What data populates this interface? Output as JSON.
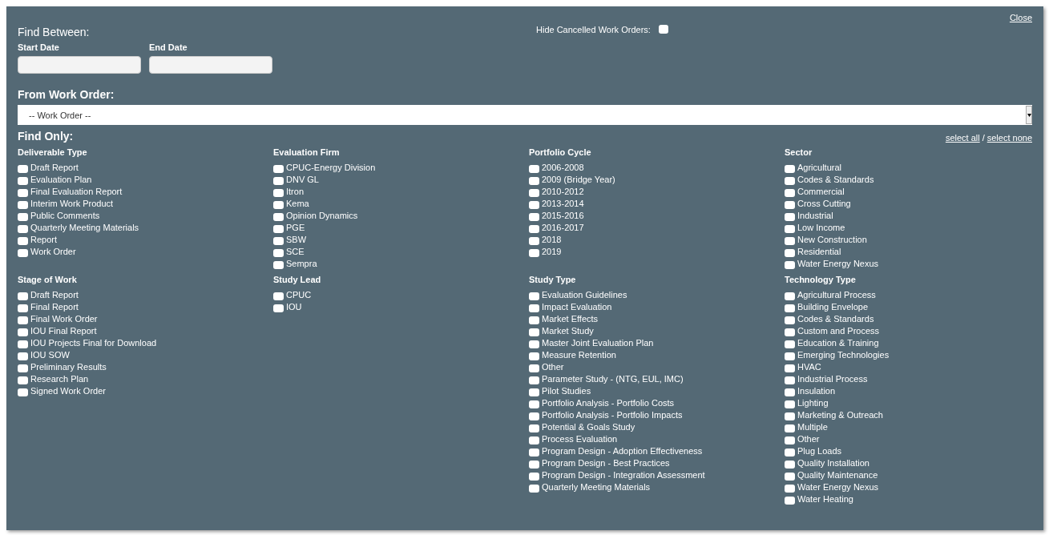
{
  "close_link": "Close",
  "find_between": {
    "title": "Find Between:",
    "start_date": {
      "label": "Start Date"
    },
    "end_date": {
      "label": "End Date"
    }
  },
  "hide_cancelled": {
    "label": "Hide Cancelled Work Orders:",
    "checked": false
  },
  "from_work_order": {
    "title": "From Work Order:",
    "value": "-- Work Order --"
  },
  "find_only": {
    "title": "Find Only:",
    "select_all": "select all",
    "separator": "/",
    "select_none": "select none",
    "groups": [
      {
        "title": "Deliverable Type",
        "items": [
          {
            "label": "Draft Report",
            "checked": false
          },
          {
            "label": "Evaluation Plan",
            "checked": false
          },
          {
            "label": "Final Evaluation Report",
            "checked": false
          },
          {
            "label": "Interim Work Product",
            "checked": false
          },
          {
            "label": "Public Comments",
            "checked": false
          },
          {
            "label": "Quarterly Meeting Materials",
            "checked": false
          },
          {
            "label": "Report",
            "checked": false
          },
          {
            "label": "Work Order",
            "checked": false
          }
        ]
      },
      {
        "title": "Evaluation Firm",
        "items": [
          {
            "label": "CPUC-Energy Division",
            "checked": false
          },
          {
            "label": "DNV GL",
            "checked": false
          },
          {
            "label": "Itron",
            "checked": false
          },
          {
            "label": "Kema",
            "checked": false
          },
          {
            "label": "Opinion Dynamics",
            "checked": false
          },
          {
            "label": "PGE",
            "checked": false
          },
          {
            "label": "SBW",
            "checked": false
          },
          {
            "label": "SCE",
            "checked": false
          },
          {
            "label": "Sempra",
            "checked": false
          }
        ]
      },
      {
        "title": "Portfolio Cycle",
        "items": [
          {
            "label": "2006-2008",
            "checked": false
          },
          {
            "label": "2009 (Bridge Year)",
            "checked": false
          },
          {
            "label": "2010-2012",
            "checked": false
          },
          {
            "label": "2013-2014",
            "checked": false
          },
          {
            "label": "2015-2016",
            "checked": false
          },
          {
            "label": "2016-2017",
            "checked": false
          },
          {
            "label": "2018",
            "checked": false
          },
          {
            "label": "2019",
            "checked": false
          }
        ]
      },
      {
        "title": "Sector",
        "items": [
          {
            "label": "Agricultural",
            "checked": false
          },
          {
            "label": "Codes & Standards",
            "checked": false
          },
          {
            "label": "Commercial",
            "checked": false
          },
          {
            "label": "Cross Cutting",
            "checked": false
          },
          {
            "label": "Industrial",
            "checked": false
          },
          {
            "label": "Low Income",
            "checked": false
          },
          {
            "label": "New Construction",
            "checked": false
          },
          {
            "label": "Residential",
            "checked": false
          },
          {
            "label": "Water Energy Nexus",
            "checked": false
          }
        ]
      },
      {
        "title": "Stage of Work",
        "items": [
          {
            "label": "Draft Report",
            "checked": false
          },
          {
            "label": "Final Report",
            "checked": false
          },
          {
            "label": "Final Work Order",
            "checked": false
          },
          {
            "label": "IOU Final Report",
            "checked": false
          },
          {
            "label": "IOU Projects Final for Download",
            "checked": false
          },
          {
            "label": "IOU SOW",
            "checked": false
          },
          {
            "label": "Preliminary Results",
            "checked": false
          },
          {
            "label": "Research Plan",
            "checked": false
          },
          {
            "label": "Signed Work Order",
            "checked": false
          }
        ]
      },
      {
        "title": "Study Lead",
        "items": [
          {
            "label": "CPUC",
            "checked": false
          },
          {
            "label": "IOU",
            "checked": false
          }
        ]
      },
      {
        "title": "Study Type",
        "items": [
          {
            "label": "Evaluation Guidelines",
            "checked": false
          },
          {
            "label": "Impact Evaluation",
            "checked": false
          },
          {
            "label": "Market Effects",
            "checked": false
          },
          {
            "label": "Market Study",
            "checked": false
          },
          {
            "label": "Master Joint Evaluation Plan",
            "checked": false
          },
          {
            "label": "Measure Retention",
            "checked": false
          },
          {
            "label": "Other",
            "checked": false
          },
          {
            "label": "Parameter Study - (NTG, EUL, IMC)",
            "checked": false
          },
          {
            "label": "Pilot Studies",
            "checked": false
          },
          {
            "label": "Portfolio Analysis - Portfolio Costs",
            "checked": false
          },
          {
            "label": "Portfolio Analysis - Portfolio Impacts",
            "checked": false
          },
          {
            "label": "Potential & Goals Study",
            "checked": false
          },
          {
            "label": "Process Evaluation",
            "checked": false
          },
          {
            "label": "Program Design - Adoption Effectiveness",
            "checked": false
          },
          {
            "label": "Program Design - Best Practices",
            "checked": false
          },
          {
            "label": "Program Design - Integration Assessment",
            "checked": false
          },
          {
            "label": "Quarterly Meeting Materials",
            "checked": false
          }
        ]
      },
      {
        "title": "Technology Type",
        "items": [
          {
            "label": "Agricultural Process",
            "checked": false
          },
          {
            "label": "Building Envelope",
            "checked": false
          },
          {
            "label": "Codes & Standards",
            "checked": false
          },
          {
            "label": "Custom and Process",
            "checked": false
          },
          {
            "label": "Education & Training",
            "checked": false
          },
          {
            "label": "Emerging Technologies",
            "checked": false
          },
          {
            "label": "HVAC",
            "checked": false
          },
          {
            "label": "Industrial Process",
            "checked": false
          },
          {
            "label": "Insulation",
            "checked": false
          },
          {
            "label": "Lighting",
            "checked": false
          },
          {
            "label": "Marketing & Outreach",
            "checked": false
          },
          {
            "label": "Multiple",
            "checked": false
          },
          {
            "label": "Other",
            "checked": false
          },
          {
            "label": "Plug Loads",
            "checked": false
          },
          {
            "label": "Quality Installation",
            "checked": false
          },
          {
            "label": "Quality Maintenance",
            "checked": false
          },
          {
            "label": "Water Energy Nexus",
            "checked": false
          },
          {
            "label": "Water Heating",
            "checked": false
          }
        ]
      }
    ]
  }
}
